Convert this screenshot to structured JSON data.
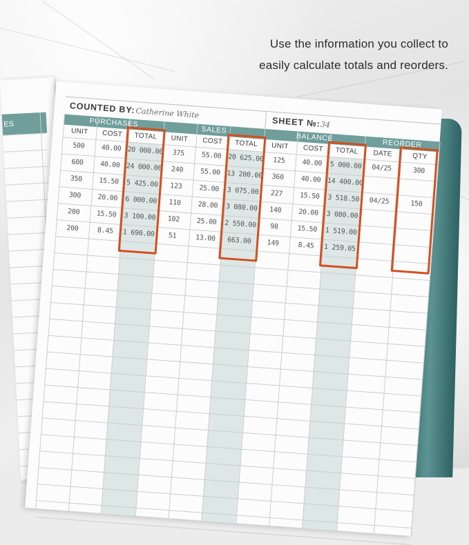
{
  "headline": {
    "line1": "Use the information you collect to",
    "line2": "easily calculate totals and reorders."
  },
  "notebook": {
    "left_page_header": "ES",
    "counted_by_label": "COUNTED BY:",
    "counted_by_value": "Catherine White",
    "sheet_label": "SHEET №:",
    "sheet_value": "34",
    "accent_color": "#6f9e9b",
    "shade_color": "#dde8e6",
    "highlight_color": "#d24f1f",
    "sections": [
      {
        "name": "PURCHASES",
        "columns": [
          "UNIT",
          "COST",
          "TOTAL"
        ]
      },
      {
        "name": "SALES",
        "columns": [
          "UNIT",
          "COST",
          "TOTAL"
        ]
      },
      {
        "name": "BALANCE",
        "columns": [
          "UNIT",
          "COST",
          "TOTAL"
        ]
      },
      {
        "name": "REORDER",
        "columns": [
          "DATE",
          "QTY"
        ]
      }
    ],
    "purchases": [
      [
        "500",
        "40.00",
        "20 000.00"
      ],
      [
        "600",
        "40.00",
        "24 000.00"
      ],
      [
        "350",
        "15.50",
        "5 425.00"
      ],
      [
        "300",
        "20.00",
        "6 000.00"
      ],
      [
        "200",
        "15.50",
        "3 100.00"
      ],
      [
        "200",
        "8.45",
        "1 690.00"
      ]
    ],
    "sales": [
      [
        "375",
        "55.00",
        "20 625.00"
      ],
      [
        "240",
        "55.00",
        "13 200.00"
      ],
      [
        "123",
        "25.00",
        "3 075.00"
      ],
      [
        "110",
        "28.00",
        "3 080.00"
      ],
      [
        "102",
        "25.00",
        "2 550.00"
      ],
      [
        "51",
        "13.00",
        "663.00"
      ]
    ],
    "balance": [
      [
        "125",
        "40.00",
        "5 000.00"
      ],
      [
        "360",
        "40.00",
        "14 400.00"
      ],
      [
        "227",
        "15.50",
        "3 518.50"
      ],
      [
        "140",
        "20.00",
        "3 080.00"
      ],
      [
        "98",
        "15.50",
        "1 519.00"
      ],
      [
        "149",
        "8.45",
        "1 259.05"
      ]
    ],
    "reorder": [
      [
        "04/25",
        "300"
      ],
      [
        "",
        ""
      ],
      [
        "04/25",
        "150"
      ],
      [
        "",
        ""
      ],
      [
        "",
        ""
      ],
      [
        "",
        ""
      ]
    ]
  }
}
